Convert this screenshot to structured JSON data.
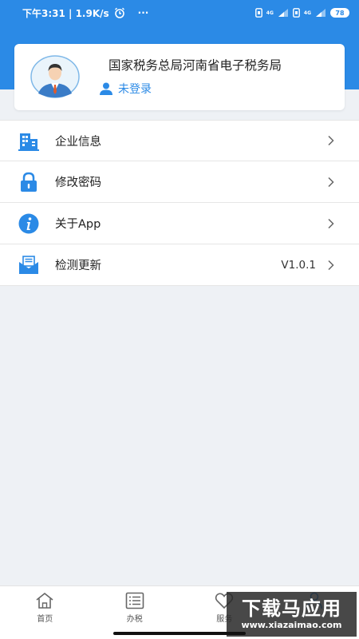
{
  "status_bar": {
    "time_speed": "下午3:31 | 1.9K/s",
    "more": "···",
    "signal_label_1": "4G",
    "signal_label_2": "4G",
    "battery": "78"
  },
  "profile": {
    "org_name": "国家税务总局河南省电子税务局",
    "login_status": "未登录"
  },
  "menu": {
    "items": [
      {
        "label": "企业信息",
        "icon": "building-icon",
        "value": ""
      },
      {
        "label": "修改密码",
        "icon": "lock-icon",
        "value": ""
      },
      {
        "label": "关于App",
        "icon": "info-icon",
        "value": ""
      },
      {
        "label": "检测更新",
        "icon": "envelope-icon",
        "value": "V1.0.1"
      }
    ]
  },
  "tabs": [
    {
      "label": "首页",
      "icon": "home-icon"
    },
    {
      "label": "办税",
      "icon": "list-icon"
    },
    {
      "label": "服务",
      "icon": "heart-icon"
    },
    {
      "label": "",
      "icon": "user-icon"
    }
  ],
  "watermark": {
    "title": "下载马应用",
    "url": "www.xiazaimao.com"
  },
  "colors": {
    "primary": "#2b8ae6",
    "background": "#eef1f5"
  }
}
